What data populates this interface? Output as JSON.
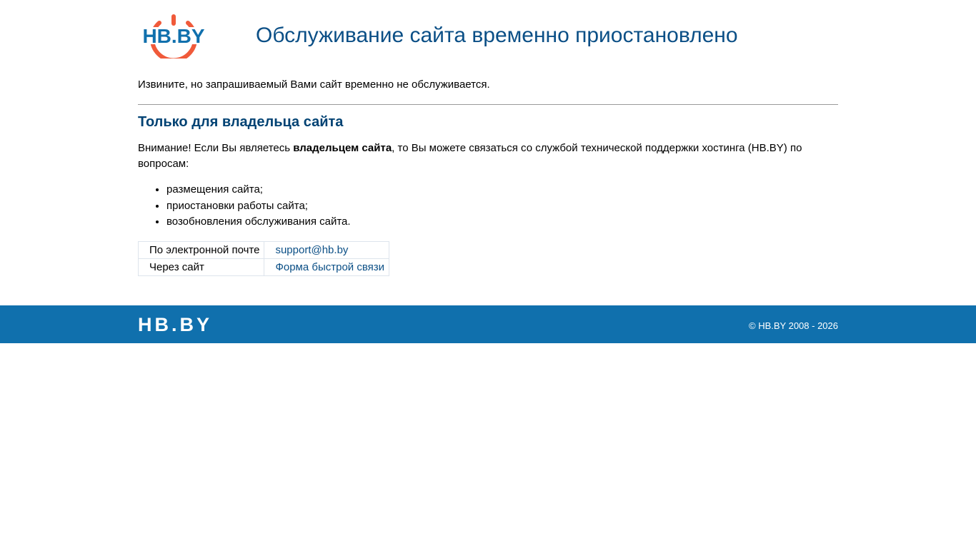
{
  "logo_text": "HB.BY",
  "title": "Обслуживание сайта временно приостановлено",
  "intro": "Извините, но запрашиваемый Вами сайт временно не обслуживается.",
  "owner_heading": "Только для владельца сайта",
  "notice": {
    "before": "Внимание! Если Вы являетесь ",
    "bold": "владельцем сайта",
    "after": ", то Вы можете связаться со службой технической поддержки хостинга (HB.BY) по вопросам:"
  },
  "topics": [
    "размещения сайта;",
    "приостановки работы сайта;",
    "возобновления обслуживания сайта."
  ],
  "contacts": [
    {
      "label": "По электронной почте",
      "link": "support@hb.by"
    },
    {
      "label": "Через сайт",
      "link": "Форма быстрой связи"
    }
  ],
  "footer": {
    "copyright": "© HB.BY 2008 - 2026"
  },
  "colors": {
    "brand_blue": "#1070ad",
    "brand_orange": "#f05a3a",
    "heading": "#0b4f86"
  }
}
